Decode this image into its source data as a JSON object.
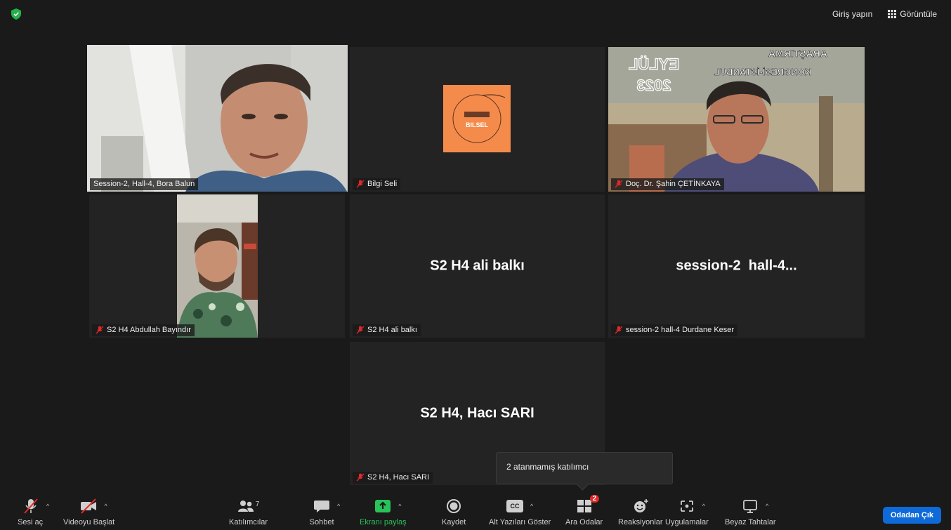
{
  "topbar": {
    "signin_label": "Giriş yapın",
    "view_label": "Görüntüle"
  },
  "tiles": [
    {
      "name": "Session-2, Hall-4, Bora Balun",
      "muted": false,
      "video": true
    },
    {
      "name": "Bilgi Seli",
      "muted": true,
      "video": "logo",
      "logo_text": "BILSEL"
    },
    {
      "name": "Doç. Dr. Şahin ÇETİNKAYA",
      "muted": true,
      "video": true,
      "backdrop_text": [
        "ARAŞTIRMA",
        "KONGRESİ-İSTANBUL",
        "EYLÜL",
        "2023"
      ]
    },
    {
      "name": "S2 H4 Abdullah Bayındır",
      "muted": true,
      "video": true
    },
    {
      "name": "S2 H4 ali balkı",
      "display": "S2 H4 ali balkı",
      "muted": true,
      "video": false
    },
    {
      "name": "session-2 hall-4 Durdane Keser",
      "display": "session-2  hall-4...",
      "muted": true,
      "video": false
    },
    {
      "name": "S2 H4, Hacı SARI",
      "display": "S2 H4, Hacı SARI",
      "muted": true,
      "video": false
    }
  ],
  "tooltip": {
    "text": "2 atanmamış katılımcı"
  },
  "toolbar": {
    "audio_label": "Sesi aç",
    "video_label": "Videoyu Başlat",
    "participants_label": "Katılımcılar",
    "participants_count": "7",
    "chat_label": "Sohbet",
    "share_label": "Ekranı paylaş",
    "record_label": "Kaydet",
    "captions_label": "Alt Yazıları Göster",
    "captions_icon_text": "CC",
    "breakout_label": "Ara Odalar",
    "breakout_badge": "2",
    "reactions_label": "Reaksiyonlar",
    "apps_label": "Uygulamalar",
    "whiteboard_label": "Beyaz Tahtalar",
    "leave_label": "Odadan Çık"
  },
  "colors": {
    "background": "#1a1a1a",
    "tile": "#232323",
    "active_speaker": "#c8e38a",
    "share_green": "#29c25a",
    "leave_blue": "#0e6ad8",
    "muted_red": "#e02828",
    "logo_orange": "#f48b4b"
  }
}
